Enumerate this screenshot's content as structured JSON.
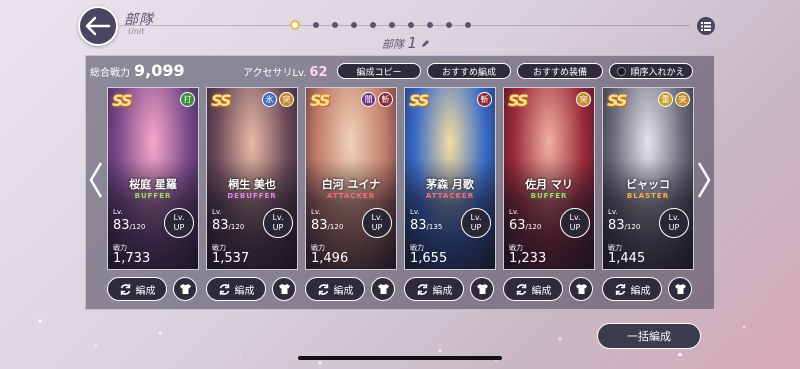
{
  "header": {
    "title": "部隊",
    "subtitle": "Unit",
    "unit_prefix": "部隊",
    "unit_number": "1",
    "page_count": 10,
    "active_page": 1
  },
  "summary": {
    "power_label": "総合戦力",
    "power_value": "9,099",
    "accessory_label": "アクセサリLv.",
    "accessory_value": "62"
  },
  "buttons": {
    "copy": "編成コピー",
    "recommend_formation": "おすすめ編成",
    "recommend_equipment": "おすすめ装備",
    "reorder": "順序入れかえ",
    "bulk": "一括編成"
  },
  "cards": [
    {
      "rarity": "SS",
      "name": "桜庭 星羅",
      "role": "BUFFER",
      "role_color": "#9be06a",
      "badges": [
        {
          "t": "打",
          "c": "#3e8c3a"
        }
      ],
      "lv_label": "Lv.",
      "level": "83",
      "max": "/120",
      "power_label": "戦力",
      "power": "1,733",
      "lvup": [
        "Lv.",
        "UP"
      ],
      "edit": "編成",
      "art": [
        "#f6a7c8",
        "#7a4a8a",
        "#2b2140"
      ]
    },
    {
      "rarity": "SS",
      "name": "桐生 美也",
      "role": "DEBUFFER",
      "role_color": "#e08ae8",
      "badges": [
        {
          "t": "氷",
          "c": "#3d6fc4"
        },
        {
          "t": "突",
          "c": "#c48a2a"
        }
      ],
      "lv_label": "Lv.",
      "level": "83",
      "max": "/120",
      "power_label": "戦力",
      "power": "1,537",
      "lvup": [
        "Lv.",
        "UP"
      ],
      "edit": "編成",
      "art": [
        "#e9b9a4",
        "#6a4a5a",
        "#241a2a"
      ]
    },
    {
      "rarity": "SS",
      "name": "白河 ユイナ",
      "role": "ATTACKER",
      "role_color": "#ff6a7a",
      "badges": [
        {
          "t": "闇",
          "c": "#6a3a8a"
        },
        {
          "t": "斬",
          "c": "#8a2a3a"
        }
      ],
      "lv_label": "Lv.",
      "level": "83",
      "max": "/120",
      "power_label": "戦力",
      "power": "1,496",
      "lvup": [
        "Lv.",
        "UP"
      ],
      "edit": "編成",
      "art": [
        "#f0d2b8",
        "#c07a6a",
        "#3a2430"
      ]
    },
    {
      "rarity": "SS",
      "name": "茅森 月歌",
      "role": "ATTACKER",
      "role_color": "#ff6a7a",
      "badges": [
        {
          "t": "斬",
          "c": "#8a2a3a"
        }
      ],
      "lv_label": "Lv.",
      "level": "83",
      "max": "/135",
      "power_label": "戦力",
      "power": "1,655",
      "lvup": [
        "Lv.",
        "UP"
      ],
      "edit": "編成",
      "art": [
        "#f2dca0",
        "#3a6ac8",
        "#1a2a4a"
      ]
    },
    {
      "rarity": "SS",
      "name": "佐月 マリ",
      "role": "BUFFER",
      "role_color": "#9be06a",
      "badges": [
        {
          "t": "突",
          "c": "#c48a2a"
        }
      ],
      "lv_label": "Lv.",
      "level": "63",
      "max": "/120",
      "power_label": "戦力",
      "power": "1,233",
      "lvup": [
        "Lv.",
        "UP"
      ],
      "edit": "編成",
      "art": [
        "#f0b0a0",
        "#9a2a3a",
        "#2a1420"
      ]
    },
    {
      "rarity": "SS",
      "name": "ビャッコ",
      "role": "BLASTER",
      "role_color": "#ffb04a",
      "badges": [
        {
          "t": "雷",
          "c": "#c4a02a"
        },
        {
          "t": "突",
          "c": "#c48a2a"
        }
      ],
      "lv_label": "Lv.",
      "level": "83",
      "max": "/120",
      "power_label": "戦力",
      "power": "1,445",
      "lvup": [
        "Lv.",
        "UP"
      ],
      "edit": "編成",
      "art": [
        "#e6e2ea",
        "#6a6a7a",
        "#20202a"
      ]
    }
  ]
}
